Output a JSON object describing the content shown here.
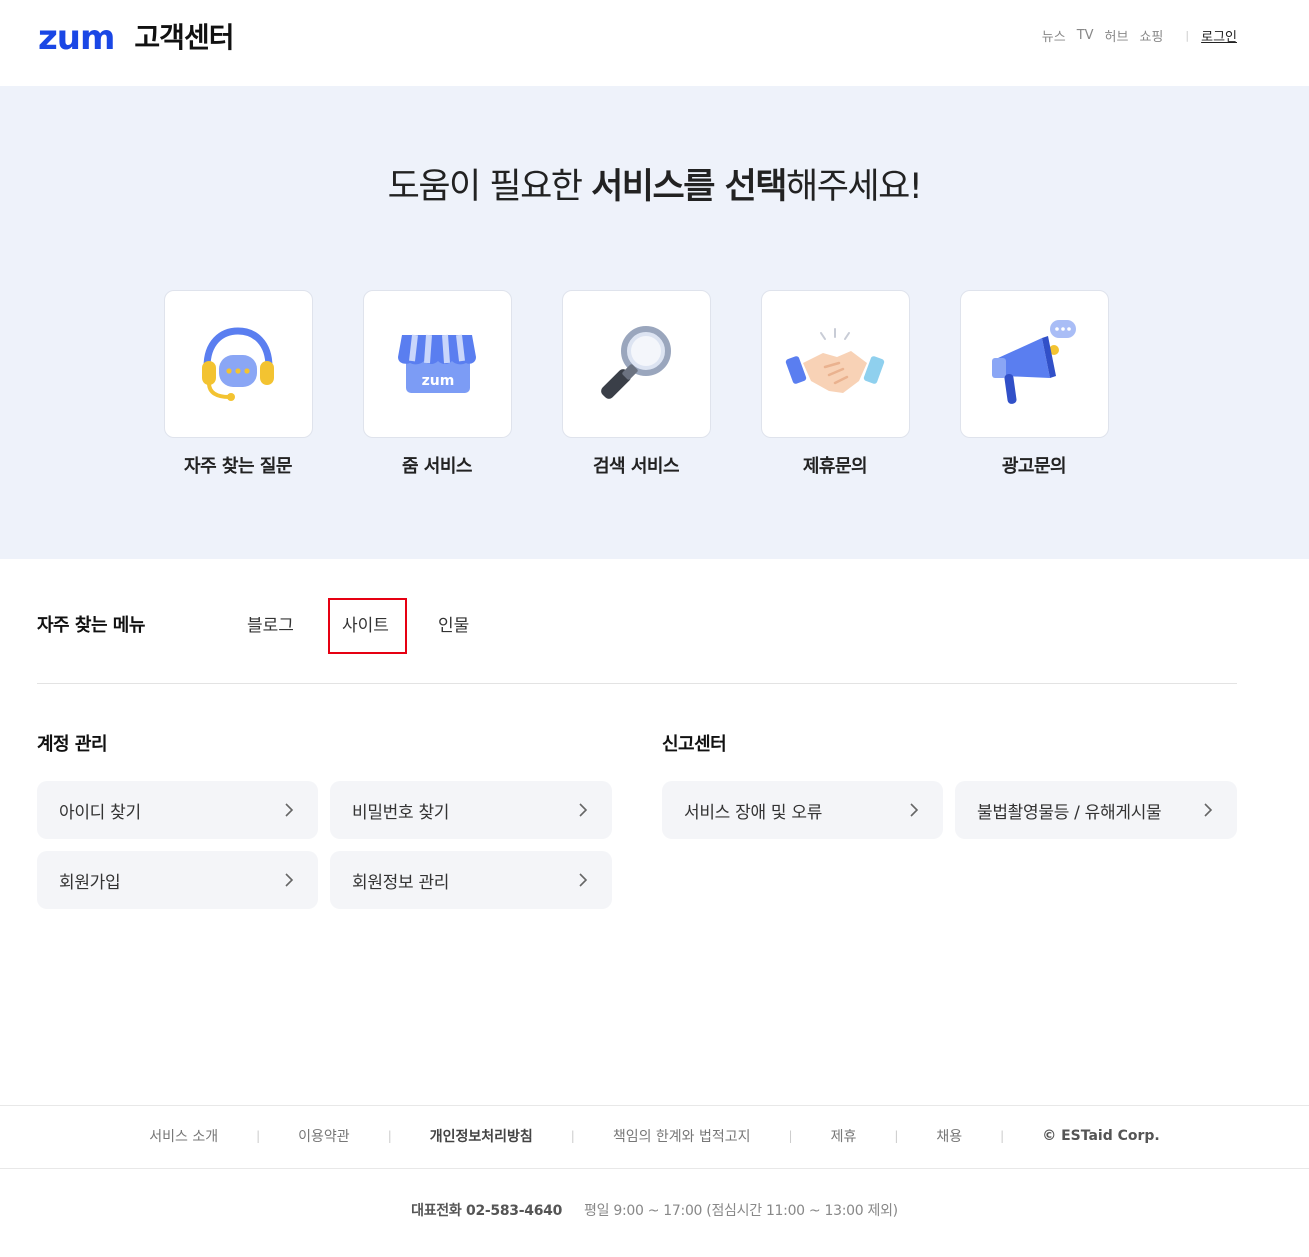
{
  "header": {
    "logo": "zum",
    "title": "고객센터",
    "nav": [
      "뉴스",
      "TV",
      "허브",
      "쇼핑"
    ],
    "login": "로그인"
  },
  "hero": {
    "title_pre": "도움이 필요한 ",
    "title_bold": "서비스를 선택",
    "title_post": "해주세요!",
    "services": [
      {
        "label": "자주 찾는 질문",
        "icon": "headset-icon"
      },
      {
        "label": "줌 서비스",
        "icon": "store-icon"
      },
      {
        "label": "검색 서비스",
        "icon": "magnifier-icon"
      },
      {
        "label": "제휴문의",
        "icon": "handshake-icon"
      },
      {
        "label": "광고문의",
        "icon": "megaphone-icon"
      }
    ]
  },
  "frequent": {
    "title": "자주 찾는 메뉴",
    "tabs": [
      "블로그",
      "사이트",
      "인물"
    ]
  },
  "account": {
    "title": "계정 관리",
    "items": [
      "아이디 찾기",
      "비밀번호 찾기",
      "회원가입",
      "회원정보 관리"
    ]
  },
  "report": {
    "title": "신고센터",
    "items": [
      "서비스 장애 및 오류",
      "불법촬영물등 / 유해게시물"
    ]
  },
  "footer": {
    "links": [
      "서비스 소개",
      "이용약관",
      "개인정보처리방침",
      "책임의 한계와 법적고지",
      "제휴",
      "채용"
    ],
    "copyright": "© ESTaid Corp.",
    "phone_label": "대표전화 02-583-4640",
    "hours": "평일 9:00 ~ 17:00 (점심시간 11:00 ~ 13:00 제외)"
  },
  "colors": {
    "brand": "#1a47e5",
    "hero_bg": "#eef2fa",
    "highlight": "#e60012"
  }
}
